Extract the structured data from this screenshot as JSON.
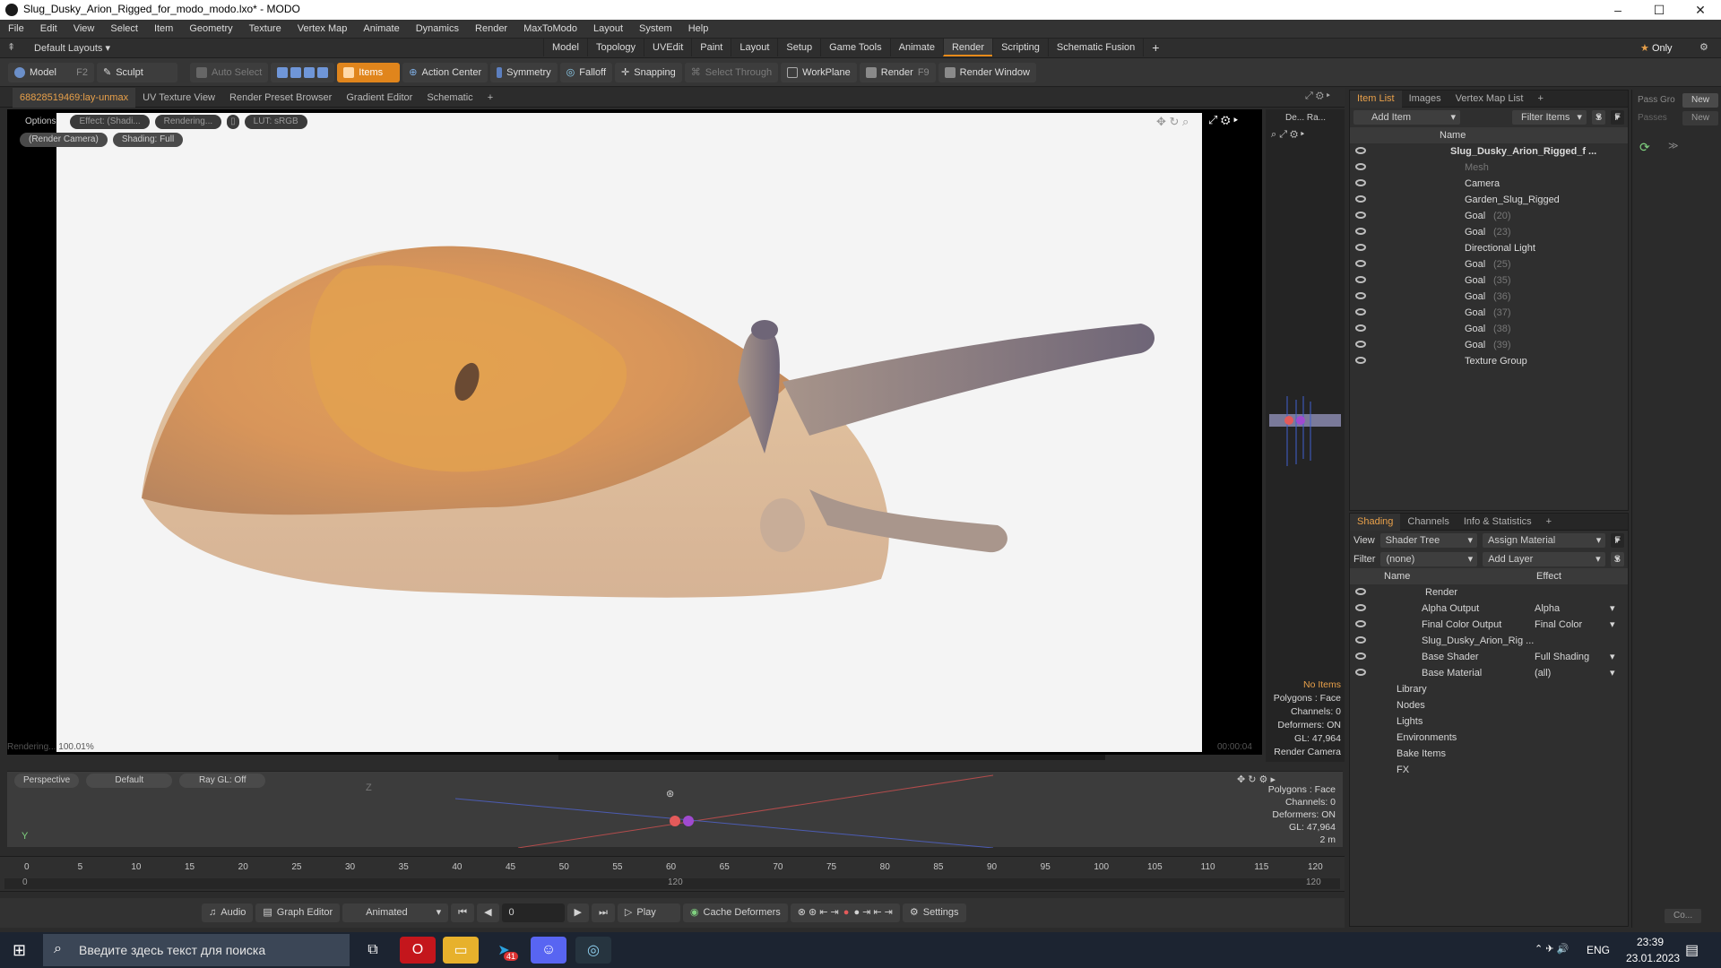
{
  "window": {
    "title": "Slug_Dusky_Arion_Rigged_for_modo_modo.lxo* - MODO",
    "minimize": "–",
    "maximize": "☐",
    "close": "✕"
  },
  "menu": [
    "File",
    "Edit",
    "View",
    "Select",
    "Item",
    "Geometry",
    "Texture",
    "Vertex Map",
    "Animate",
    "Dynamics",
    "Render",
    "MaxToModo",
    "Layout",
    "System",
    "Help"
  ],
  "layoutbar": {
    "layouts": "Default Layouts",
    "tabs": [
      "Model",
      "Topology",
      "UVEdit",
      "Paint",
      "Layout",
      "Setup",
      "Game Tools",
      "Animate",
      "Render",
      "Scripting",
      "Schematic Fusion"
    ],
    "active_tab": "Render",
    "plus": "+",
    "only": "Only"
  },
  "toolbar": {
    "model": "Model",
    "model_key": "F2",
    "sculpt": "Sculpt",
    "auto_select": "Auto Select",
    "items": "Items",
    "action_center": "Action Center",
    "symmetry": "Symmetry",
    "falloff": "Falloff",
    "snapping": "Snapping",
    "select_through": "Select Through",
    "workplane": "WorkPlane",
    "render": "Render",
    "render_key": "F9",
    "render_window": "Render Window"
  },
  "viewport_tabs": [
    "68828519469:lay-unmax",
    "UV Texture View",
    "Render Preset Browser",
    "Gradient Editor",
    "Schematic"
  ],
  "viewport_tabs_plus": "+",
  "render_view": {
    "options": "Options",
    "effect": "Effect: (Shadi...",
    "rendering": "Rendering...",
    "lut": "LUT: sRGB",
    "camera": "(Render Camera)",
    "shading": "Shading: Full",
    "status": "Rendering... 100.01%",
    "time": "00:00:04"
  },
  "mini_view": {
    "label": "De... Ra..."
  },
  "stats_top": {
    "items": "No Items",
    "polygons": "Polygons : Face",
    "channels": "Channels: 0",
    "deformers": "Deformers: ON",
    "gl": "GL: 47,964",
    "camera": "Render Camera"
  },
  "lower_view": {
    "perspective": "Perspective",
    "default": "Default",
    "raygl": "Ray GL: Off",
    "axis_z": "Z",
    "axis_y": "Y"
  },
  "stats_bottom": {
    "polygons": "Polygons : Face",
    "channels": "Channels: 0",
    "deformers": "Deformers: ON",
    "gl": "GL: 47,964",
    "scale": "2 m"
  },
  "timeline": {
    "ticks": [
      "0",
      "5",
      "10",
      "15",
      "20",
      "25",
      "30",
      "35",
      "40",
      "45",
      "50",
      "55",
      "60",
      "65",
      "70",
      "75",
      "80",
      "85",
      "90",
      "95",
      "100",
      "105",
      "110",
      "115",
      "120"
    ],
    "start": "0",
    "mid": "120",
    "end": "120"
  },
  "transport": {
    "audio": "Audio",
    "graph_editor": "Graph Editor",
    "animated": "Animated",
    "frame": "0",
    "play": "Play",
    "cache": "Cache Deformers",
    "settings": "Settings"
  },
  "item_list": {
    "tabs": [
      "Item List",
      "Images",
      "Vertex Map List"
    ],
    "add_item": "Add Item",
    "filter_items": "Filter Items",
    "s": "S",
    "f": "F",
    "name_header": "Name",
    "rows": [
      {
        "label": "Slug_Dusky_Arion_Rigged_f ...",
        "indent": 0,
        "bold": true,
        "dim": false,
        "suffix": ""
      },
      {
        "label": "Mesh",
        "indent": 1,
        "bold": false,
        "dim": true,
        "suffix": ""
      },
      {
        "label": "Camera",
        "indent": 1,
        "bold": false,
        "dim": false,
        "suffix": ""
      },
      {
        "label": "Garden_Slug_Rigged",
        "indent": 1,
        "bold": false,
        "dim": false,
        "suffix": ""
      },
      {
        "label": "Goal",
        "indent": 1,
        "bold": false,
        "dim": false,
        "suffix": "(20)"
      },
      {
        "label": "Goal",
        "indent": 1,
        "bold": false,
        "dim": false,
        "suffix": "(23)"
      },
      {
        "label": "Directional Light",
        "indent": 1,
        "bold": false,
        "dim": false,
        "suffix": ""
      },
      {
        "label": "Goal",
        "indent": 1,
        "bold": false,
        "dim": false,
        "suffix": "(25)"
      },
      {
        "label": "Goal",
        "indent": 1,
        "bold": false,
        "dim": false,
        "suffix": "(35)"
      },
      {
        "label": "Goal",
        "indent": 1,
        "bold": false,
        "dim": false,
        "suffix": "(36)"
      },
      {
        "label": "Goal",
        "indent": 1,
        "bold": false,
        "dim": false,
        "suffix": "(37)"
      },
      {
        "label": "Goal",
        "indent": 1,
        "bold": false,
        "dim": false,
        "suffix": "(38)"
      },
      {
        "label": "Goal",
        "indent": 1,
        "bold": false,
        "dim": false,
        "suffix": "(39)"
      },
      {
        "label": "Texture Group",
        "indent": 1,
        "bold": false,
        "dim": false,
        "suffix": ""
      }
    ]
  },
  "shading": {
    "tabs": [
      "Shading",
      "Channels",
      "Info & Statistics"
    ],
    "view_label": "View",
    "view_value": "Shader Tree",
    "assign": "Assign Material",
    "f": "F",
    "filter_label": "Filter",
    "filter_value": "(none)",
    "add_layer": "Add Layer",
    "s": "S",
    "name_header": "Name",
    "effect_header": "Effect",
    "rows": [
      {
        "label": "Render",
        "effect": "",
        "indent": 0
      },
      {
        "label": "Alpha Output",
        "effect": "Alpha",
        "indent": 1
      },
      {
        "label": "Final Color Output",
        "effect": "Final Color",
        "indent": 1
      },
      {
        "label": "Slug_Dusky_Arion_Rig ...",
        "effect": "",
        "indent": 1
      },
      {
        "label": "Base Shader",
        "effect": "Full Shading",
        "indent": 1
      },
      {
        "label": "Base Material",
        "effect": "(all)",
        "indent": 1
      },
      {
        "label": "Library",
        "effect": "",
        "indent": 0
      },
      {
        "label": "Nodes",
        "effect": "",
        "indent": 0
      },
      {
        "label": "Lights",
        "effect": "",
        "indent": 0
      },
      {
        "label": "Environments",
        "effect": "",
        "indent": 0
      },
      {
        "label": "Bake Items",
        "effect": "",
        "indent": 0
      },
      {
        "label": "FX",
        "effect": "",
        "indent": 0
      }
    ]
  },
  "far_right": {
    "pass": "Pass Gro",
    "new": "New",
    "passes": "Passes",
    "new2": "New",
    "co": "Co..."
  },
  "taskbar": {
    "search": "Введите здесь текст для поиска",
    "lang": "ENG",
    "time": "23:39",
    "date": "23.01.2023",
    "badge": "41"
  },
  "colors": {
    "accent": "#e0851c",
    "tab_active": "#e8a04a",
    "bg": "#2b2b2b"
  }
}
